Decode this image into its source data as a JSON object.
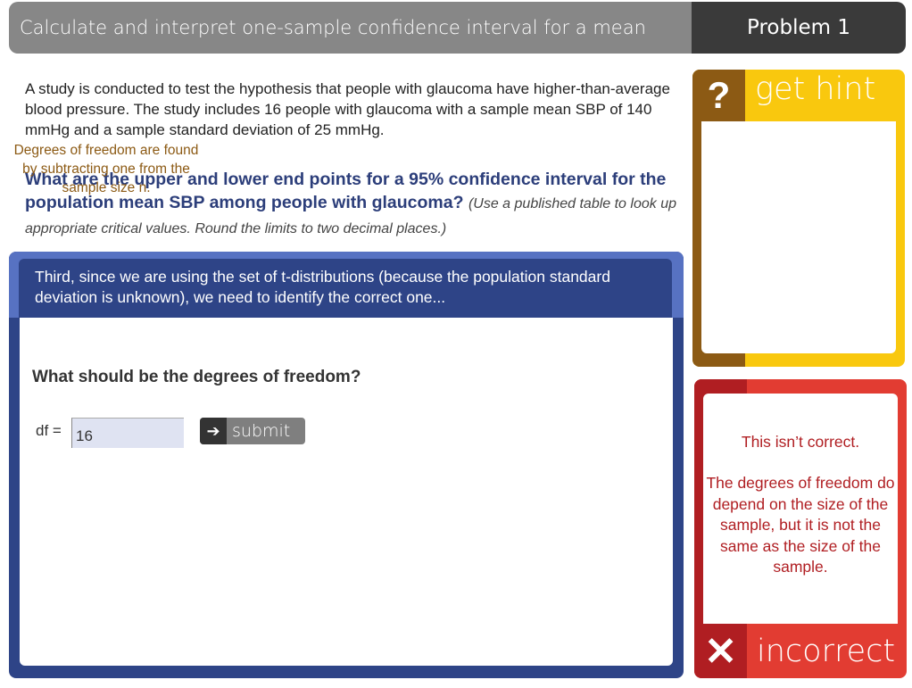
{
  "header": {
    "title": "Calculate and interpret one-sample confidence interval for a mean",
    "problem_label": "Problem 1"
  },
  "intro": {
    "text": "A study is conducted to test the hypothesis that people with glaucoma have higher-than-average blood pressure. The study includes 16 people with glaucoma with a sample mean SBP of 140 mmHg and a sample standard deviation of 25 mmHg."
  },
  "question": {
    "text": "What are the upper and lower end points for a 95% confidence interval for the population mean SBP among people with glaucoma?",
    "note": "(Use a published table to look up appropriate critical values. Round the limits to two decimal places.)"
  },
  "step": {
    "banner": "Third, since we are using the set of t-distributions (because the population standard deviation is unknown), we need to identify the correct one...",
    "prompt": "What should be the degrees of freedom?",
    "input_label": "df =",
    "input_value": "16",
    "submit_label": "submit",
    "submit_icon": "arrow-right-icon"
  },
  "hint": {
    "icon": "?",
    "label": "get hint",
    "text": "Degrees of freedom are found by subtracting one from the sample size n."
  },
  "feedback": {
    "icon": "✕",
    "label": "incorrect",
    "line1": "This isn’t correct.",
    "line2": "The degrees of freedom do depend on the size of the sample, but it is not the same as the size of the sample."
  },
  "colors": {
    "header_gray": "#878787",
    "header_dark": "#3a3a3a",
    "panel_blue": "#2e4487",
    "panel_blue_light": "#5772c2",
    "question_blue": "#2c3e7a",
    "hint_yellow": "#f9c80e",
    "hint_brown": "#8c5a14",
    "incorrect_red": "#e23c32",
    "incorrect_dark_red": "#b01e22"
  }
}
